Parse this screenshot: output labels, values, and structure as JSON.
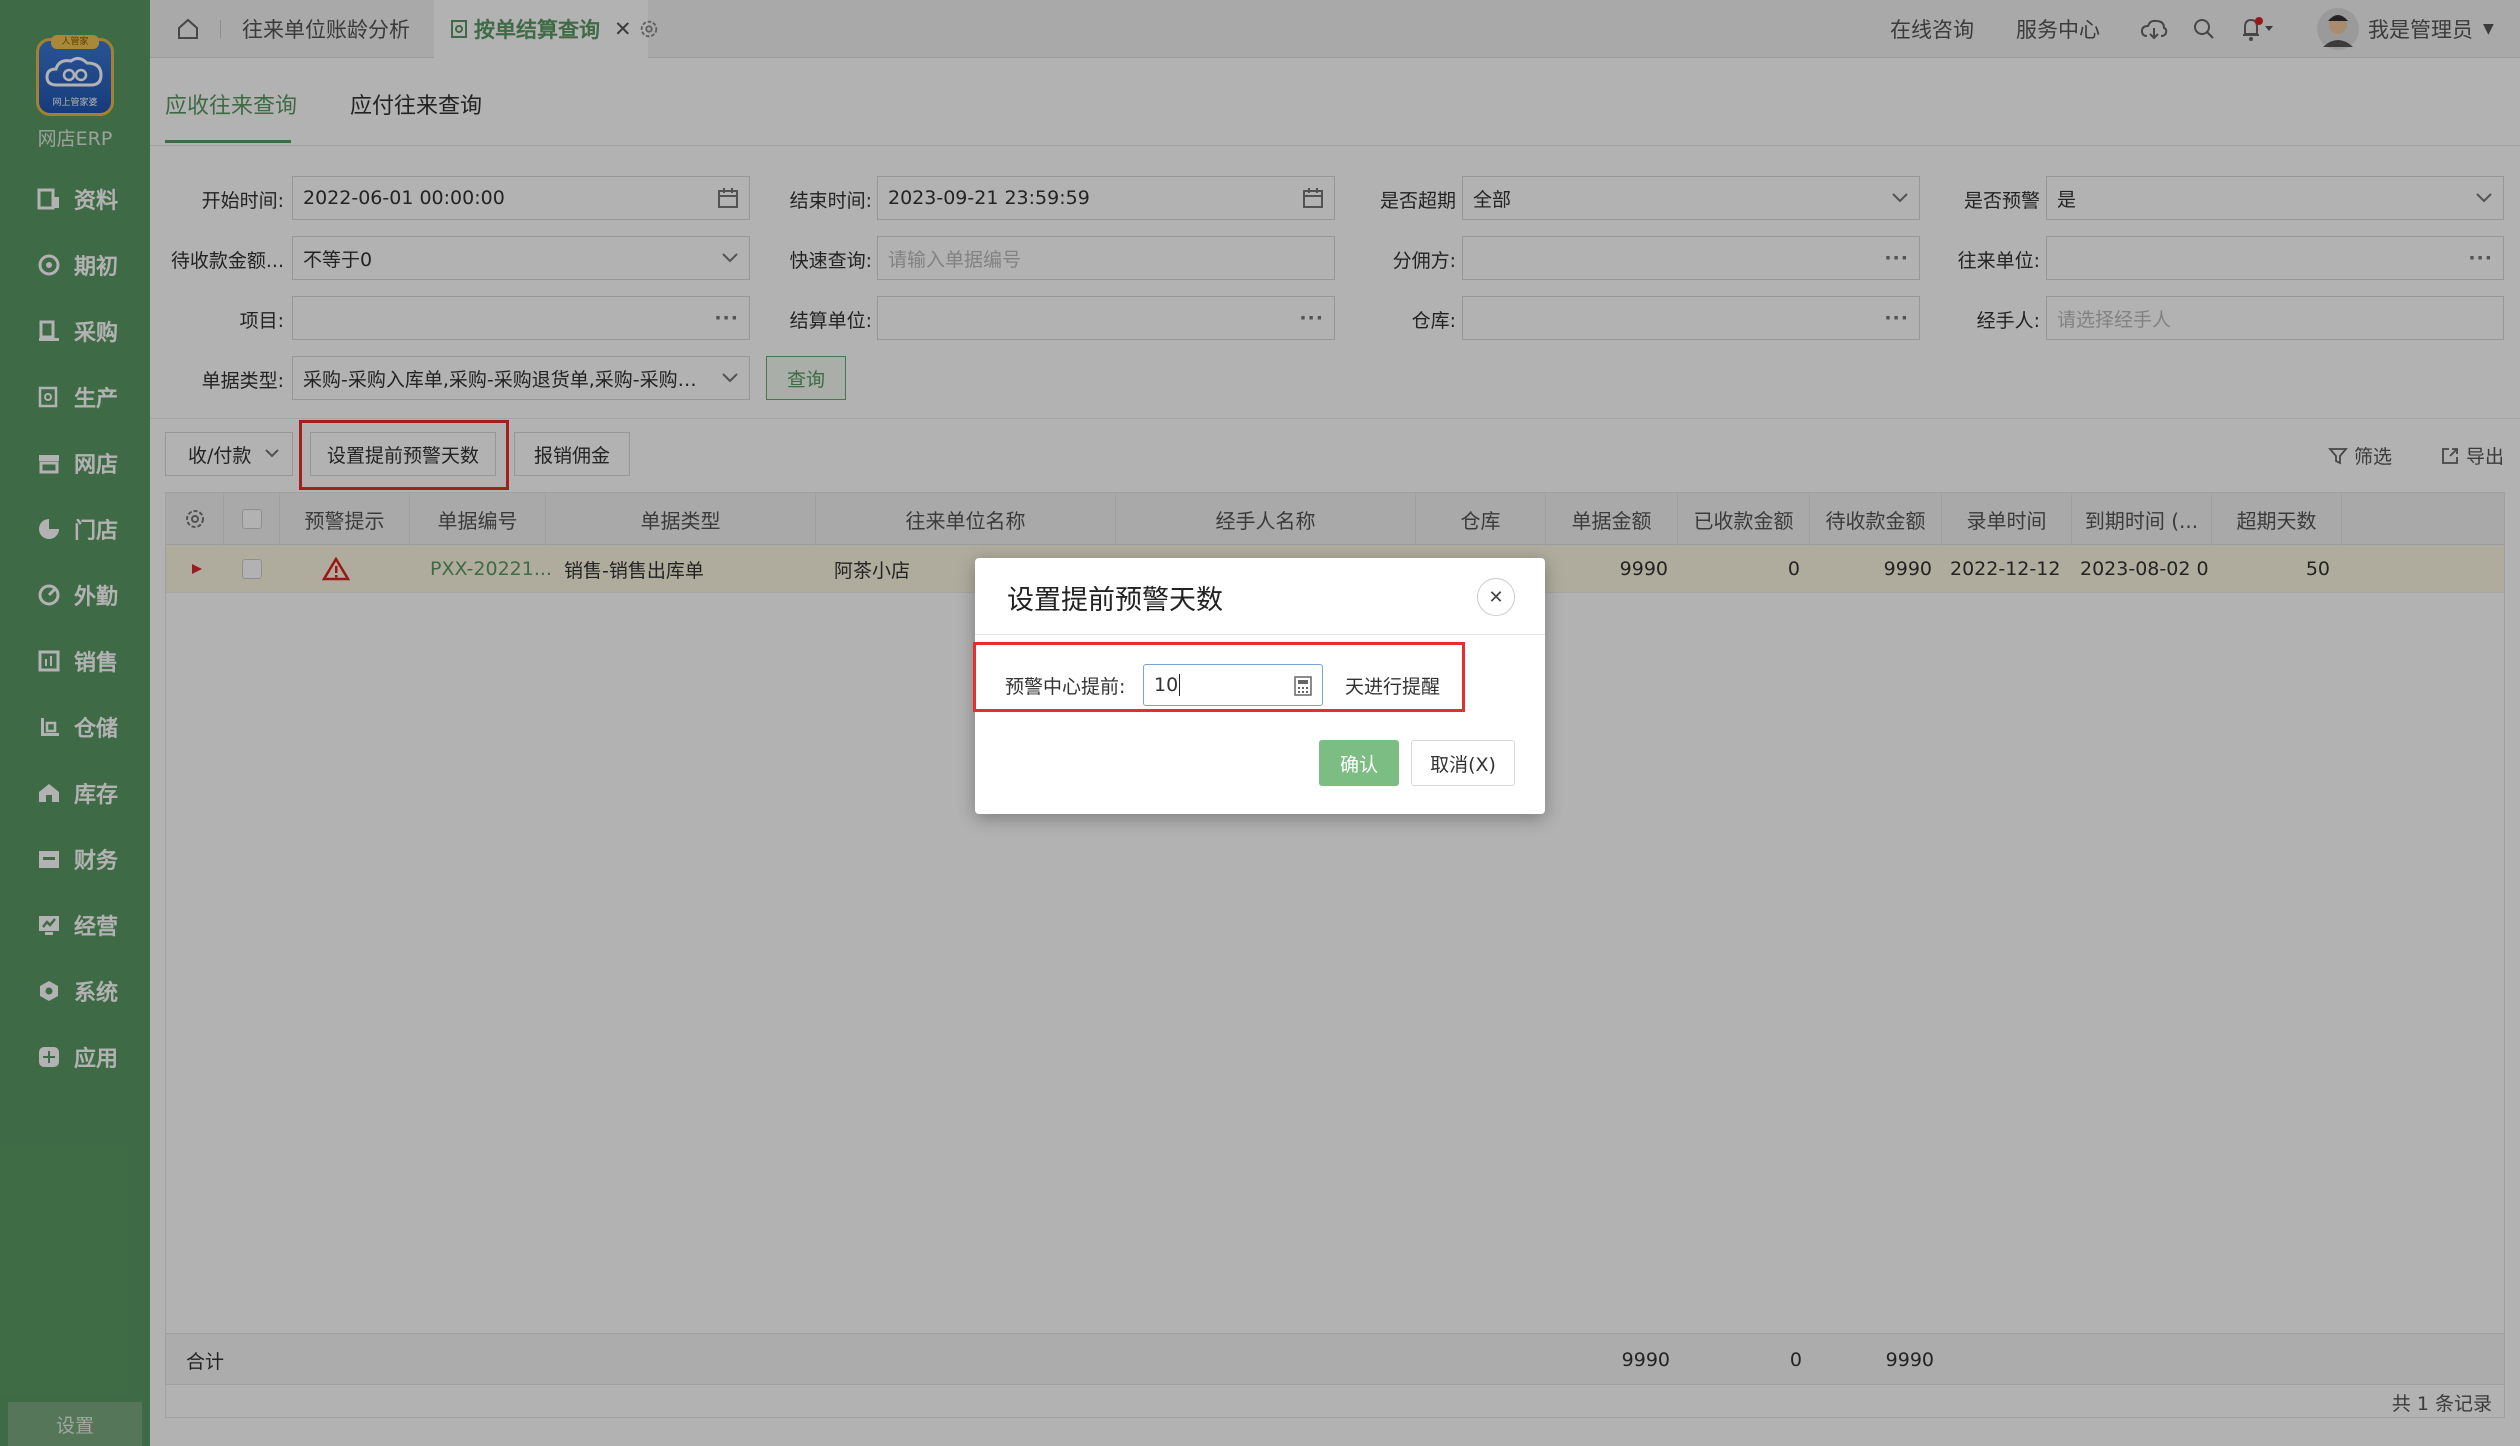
{
  "sidebar": {
    "logo_badge": "人管家",
    "logo_caption": "网上管家婆",
    "app_name": "网店ERP",
    "items": [
      {
        "label": "资料",
        "icon": "profile-icon"
      },
      {
        "label": "期初",
        "icon": "initial-icon"
      },
      {
        "label": "采购",
        "icon": "purchase-icon"
      },
      {
        "label": "生产",
        "icon": "production-icon"
      },
      {
        "label": "网店",
        "icon": "online-store-icon"
      },
      {
        "label": "门店",
        "icon": "store-icon"
      },
      {
        "label": "外勤",
        "icon": "field-icon"
      },
      {
        "label": "销售",
        "icon": "sales-icon"
      },
      {
        "label": "仓储",
        "icon": "warehouse-icon"
      },
      {
        "label": "库存",
        "icon": "inventory-icon"
      },
      {
        "label": "财务",
        "icon": "finance-icon"
      },
      {
        "label": "经营",
        "icon": "operation-icon"
      },
      {
        "label": "系统",
        "icon": "system-icon"
      },
      {
        "label": "应用",
        "icon": "app-icon"
      }
    ],
    "settings": "设置"
  },
  "topbar": {
    "tab1": "往来单位账龄分析",
    "tab2": "按单结算查询",
    "online_consult": "在线咨询",
    "service_center": "服务中心",
    "user": "我是管理员"
  },
  "subtabs": {
    "receivable": "应收往来查询",
    "payable": "应付往来查询"
  },
  "filters": {
    "start_label": "开始时间:",
    "start_value": "2022-06-01 00:00:00",
    "end_label": "结束时间:",
    "end_value": "2023-09-21 23:59:59",
    "overdue_label": "是否超期",
    "overdue_value": "全部",
    "warn_label": "是否预警",
    "warn_value": "是",
    "pending_label": "待收款金额...",
    "pending_value": "不等于0",
    "quick_label": "快速查询:",
    "quick_placeholder": "请输入单据编号",
    "commission_label": "分佣方:",
    "partner_label": "往来单位:",
    "project_label": "项目:",
    "settle_label": "结算单位:",
    "warehouse_label": "仓库:",
    "handler_label": "经手人:",
    "handler_placeholder": "请选择经手人",
    "doctype_label": "单据类型:",
    "doctype_value": "采购-采购入库单,采购-采购退货单,采购-采购换货...",
    "query": "查询"
  },
  "toolbar": {
    "pay": "收/付款",
    "set_warn": "设置提前预警天数",
    "reimburse": "报销佣金",
    "filter": "筛选",
    "export": "导出"
  },
  "table": {
    "headers": [
      "预警提示",
      "单据编号",
      "单据类型",
      "往来单位名称",
      "经手人名称",
      "仓库",
      "单据金额",
      "已收款金额",
      "待收款金额",
      "录单时间",
      "到期时间 (...",
      "超期天数"
    ],
    "row": {
      "doc_no": "PXX-20221...",
      "doc_type": "销售-销售出库单",
      "partner": "阿茶小店",
      "amount": "9990",
      "received": "0",
      "pending": "9990",
      "entry_time": "2022-12-12 1...",
      "due_time": "2023-08-02 0...",
      "overdue_days": "50"
    },
    "footer": {
      "label": "合计",
      "amount": "9990",
      "received": "0",
      "pending": "9990"
    },
    "total": "共 1 条记录"
  },
  "dialog": {
    "title": "设置提前预警天数",
    "field_label": "预警中心提前:",
    "field_value": "10",
    "suffix": "天进行提醒",
    "confirm": "确认",
    "cancel": "取消(X)"
  }
}
